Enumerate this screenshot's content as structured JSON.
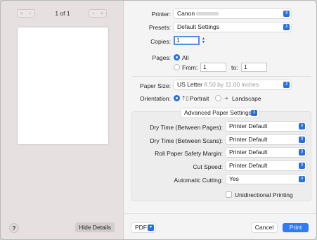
{
  "preview": {
    "page_indicator": "1 of 1",
    "nav_first": "«",
    "nav_prev": "‹",
    "nav_next": "›",
    "nav_last": "»",
    "help_label": "?",
    "hide_details_label": "Hide Details"
  },
  "settings": {
    "printer": {
      "label": "Printer:",
      "value": "Canon"
    },
    "presets": {
      "label": "Presets:",
      "value": "Default Settings"
    },
    "copies": {
      "label": "Copies:",
      "value": "1"
    },
    "pages": {
      "label": "Pages:",
      "all_label": "All",
      "from_label": "From:",
      "from_value": "1",
      "to_label": "to:",
      "to_value": "1",
      "selected": "All"
    },
    "paper_size": {
      "label": "Paper Size:",
      "value": "US Letter",
      "detail": "8.50 by 11.00 inches"
    },
    "orientation": {
      "label": "Orientation:",
      "portrait_label": "Portrait",
      "landscape_label": "Landscape",
      "selected": "Portrait"
    },
    "advanced": {
      "section_label": "Advanced Paper Settings",
      "rows": [
        {
          "label": "Dry Time (Between Pages):",
          "value": "Printer Default"
        },
        {
          "label": "Dry Time (Between Scans):",
          "value": "Printer Default"
        },
        {
          "label": "Roll Paper Safety Margin:",
          "value": "Printer Default"
        },
        {
          "label": "Cut Speed:",
          "value": "Printer Default"
        },
        {
          "label": "Automatic Cutting:",
          "value": "Yes"
        }
      ],
      "unidirectional_label": "Unidirectional Printing",
      "unidirectional_checked": false
    }
  },
  "footer": {
    "pdf_label": "PDF",
    "cancel_label": "Cancel",
    "print_label": "Print"
  },
  "colors": {
    "accent": "#2f7bf5",
    "popup_chevron": "#2a6fdb"
  },
  "icons": {
    "popup_chevron": "chevron-updown-icon",
    "portrait": "portrait-orientation-icon",
    "landscape": "landscape-orientation-icon"
  }
}
